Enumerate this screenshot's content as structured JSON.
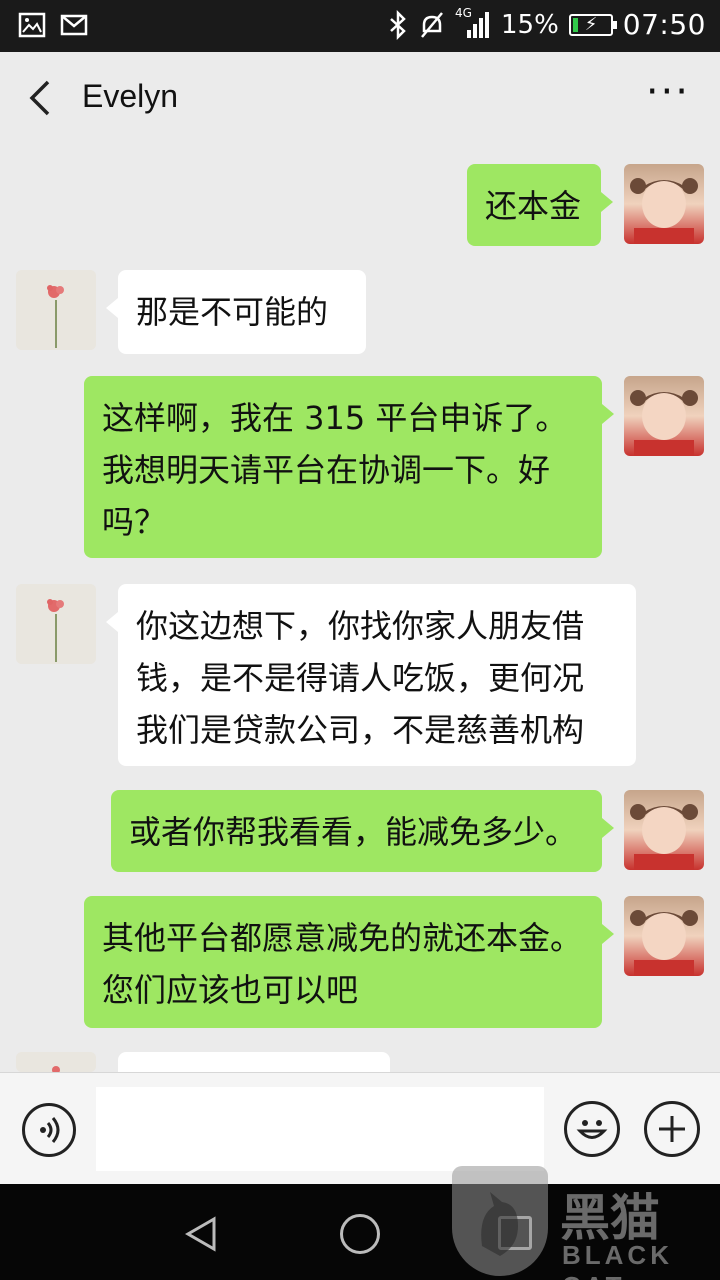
{
  "status_bar": {
    "network": "4G",
    "battery": "15%",
    "battery_level": 0.15,
    "time": "07:50"
  },
  "header": {
    "title": "Evelyn"
  },
  "messages": [
    {
      "sender": "me",
      "text": "还本金"
    },
    {
      "sender": "friend",
      "text": "那是不可能的"
    },
    {
      "sender": "me",
      "lines": [
        "这样啊，我在 315 平台申诉了。",
        "我想明天请平台在协调一下。好",
        "吗？"
      ]
    },
    {
      "sender": "friend",
      "lines": [
        "你这边想下，你找你家人朋友借",
        "钱，是不是得请人吃饭，更何况",
        "我们是贷款公司，不是慈善机构"
      ]
    },
    {
      "sender": "me",
      "text": "或者你帮我看看，能减免多少。"
    },
    {
      "sender": "me",
      "lines": [
        "其他平台都愿意减免的就还本金。",
        "您们应该也可以吧"
      ]
    }
  ],
  "input": {
    "value": ""
  },
  "watermark": {
    "brand": "黑猫",
    "brand_en": "BLACK CAT"
  },
  "icons": {
    "back": "back-arrow-icon",
    "more": "more-options-icon",
    "voice": "voice-input-icon",
    "emoji": "emoji-icon",
    "plus": "plus-icon"
  },
  "colors": {
    "my_bubble": "#9ee762",
    "friend_bubble": "#ffffff",
    "background": "#ebebeb"
  }
}
